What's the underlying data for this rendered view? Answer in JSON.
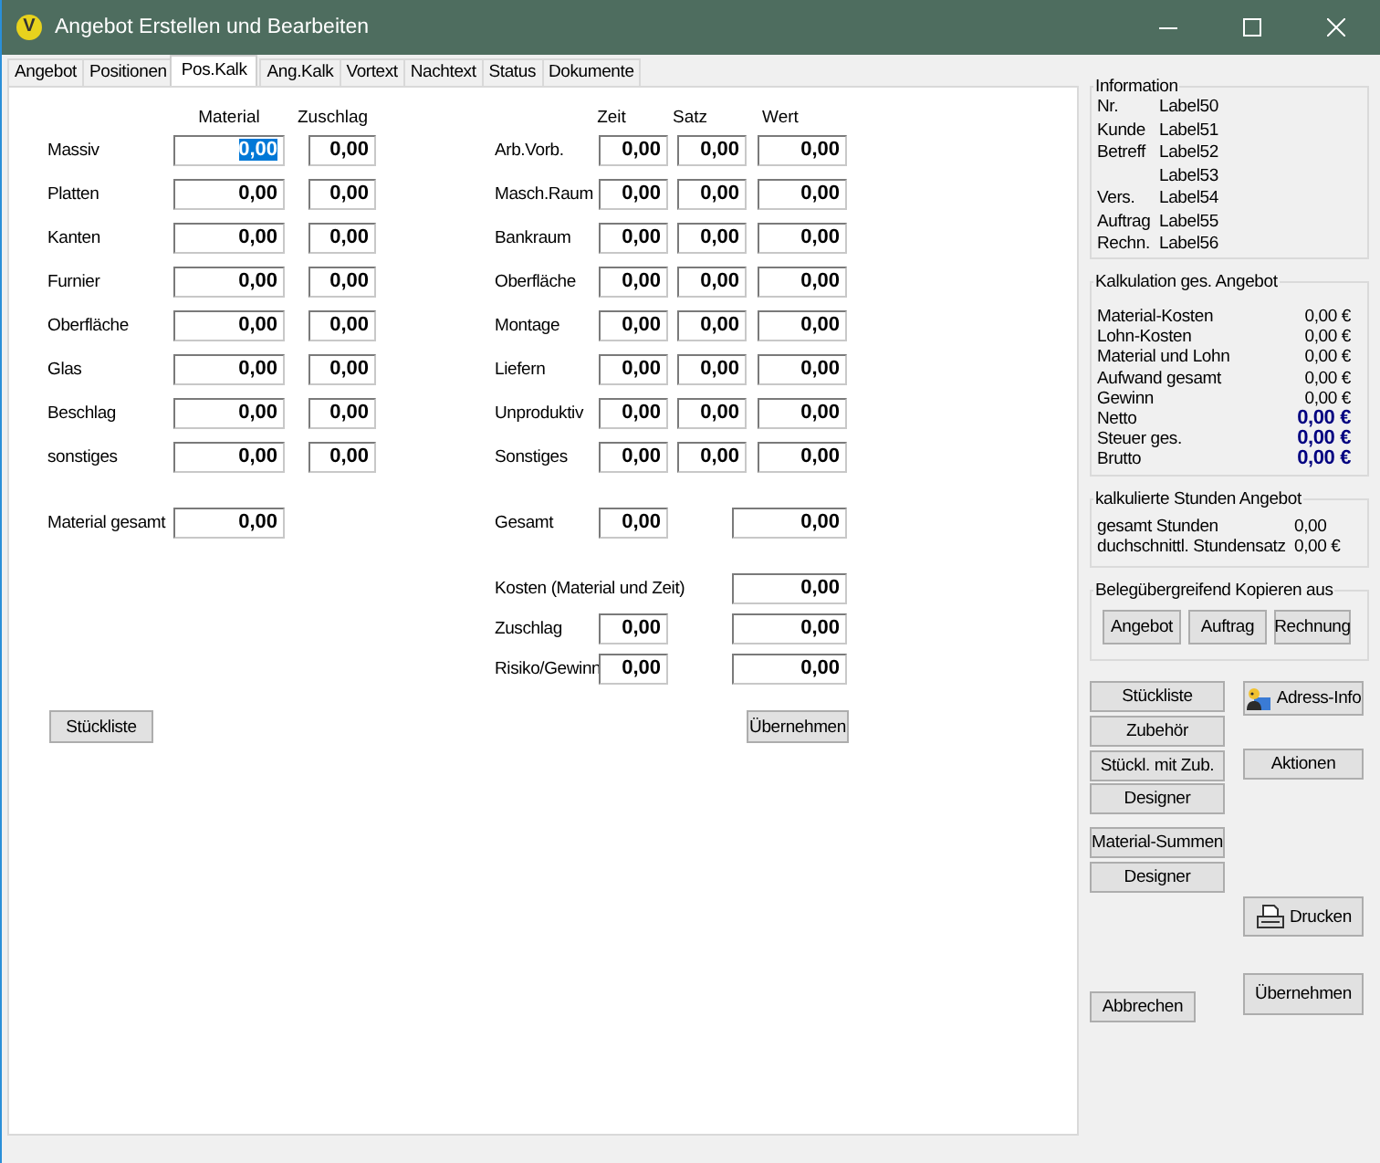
{
  "window": {
    "icon_letter": "V",
    "title": "Angebot Erstellen und Bearbeiten"
  },
  "tabs": [
    {
      "label": "Angebot",
      "selected": false
    },
    {
      "label": "Positionen",
      "selected": false
    },
    {
      "label": "Pos.Kalk",
      "selected": true
    },
    {
      "label": "Ang.Kalk",
      "selected": false
    },
    {
      "label": "Vortext",
      "selected": false
    },
    {
      "label": "Nachtext",
      "selected": false
    },
    {
      "label": "Status",
      "selected": false
    },
    {
      "label": "Dokumente",
      "selected": false
    }
  ],
  "material": {
    "headers": [
      "Material",
      "Zuschlag"
    ],
    "rows": [
      {
        "label": "Massiv",
        "material": "0,00",
        "zuschlag": "0,00",
        "selected": true
      },
      {
        "label": "Platten",
        "material": "0,00",
        "zuschlag": "0,00",
        "selected": false
      },
      {
        "label": "Kanten",
        "material": "0,00",
        "zuschlag": "0,00",
        "selected": false
      },
      {
        "label": "Furnier",
        "material": "0,00",
        "zuschlag": "0,00",
        "selected": false
      },
      {
        "label": "Oberfläche",
        "material": "0,00",
        "zuschlag": "0,00",
        "selected": false
      },
      {
        "label": "Glas",
        "material": "0,00",
        "zuschlag": "0,00",
        "selected": false
      },
      {
        "label": "Beschlag",
        "material": "0,00",
        "zuschlag": "0,00",
        "selected": false
      },
      {
        "label": "sonstiges",
        "material": "0,00",
        "zuschlag": "0,00",
        "selected": false
      }
    ],
    "total": {
      "label": "Material gesamt",
      "value": "0,00"
    }
  },
  "zeit": {
    "headers": [
      "Zeit",
      "Satz",
      "Wert"
    ],
    "rows": [
      {
        "label": "Arb.Vorb.",
        "zeit": "0,00",
        "satz": "0,00",
        "wert": "0,00"
      },
      {
        "label": "Masch.Raum",
        "zeit": "0,00",
        "satz": "0,00",
        "wert": "0,00"
      },
      {
        "label": "Bankraum",
        "zeit": "0,00",
        "satz": "0,00",
        "wert": "0,00"
      },
      {
        "label": "Oberfläche",
        "zeit": "0,00",
        "satz": "0,00",
        "wert": "0,00"
      },
      {
        "label": "Montage",
        "zeit": "0,00",
        "satz": "0,00",
        "wert": "0,00"
      },
      {
        "label": "Liefern",
        "zeit": "0,00",
        "satz": "0,00",
        "wert": "0,00"
      },
      {
        "label": "Unproduktiv",
        "zeit": "0,00",
        "satz": "0,00",
        "wert": "0,00"
      },
      {
        "label": "Sonstiges",
        "zeit": "0,00",
        "satz": "0,00",
        "wert": "0,00"
      }
    ],
    "total": {
      "label": "Gesamt",
      "zeit": "0,00",
      "wert": "0,00"
    },
    "kosten": [
      {
        "label": "Kosten (Material und Zeit)",
        "wert": "0,00"
      },
      {
        "label": "Zuschlag",
        "zeit": "0,00",
        "wert": "0,00"
      },
      {
        "label": "Risiko/Gewinn",
        "zeit": "0,00",
        "wert": "0,00"
      }
    ]
  },
  "panel_buttons": [
    "Stückliste",
    "Übernehmen"
  ],
  "information": {
    "title": "Information",
    "rows": [
      {
        "key": "Nr.",
        "value": "Label50"
      },
      {
        "key": "Kunde",
        "value": "Label51"
      },
      {
        "key": "Betreff",
        "value": "Label52"
      },
      {
        "value": "Label53"
      },
      {
        "key": "Vers.",
        "value": "Label54"
      },
      {
        "key": "Auftrag",
        "value": "Label55"
      },
      {
        "key": "Rechn.",
        "value": "Label56"
      }
    ]
  },
  "kalkulation": {
    "title": "Kalkulation ges. Angebot",
    "rows": [
      {
        "label": "Material-Kosten",
        "value": "0,00 €",
        "highlighted": false
      },
      {
        "label": "Lohn-Kosten",
        "value": "0,00 €",
        "highlighted": false
      },
      {
        "label": "Material und Lohn",
        "value": "0,00 €",
        "highlighted": false
      },
      {
        "label": "Aufwand gesamt",
        "value": "0,00 €",
        "highlighted": false
      },
      {
        "label": "Gewinn",
        "value": "0,00 €",
        "highlighted": false
      },
      {
        "label": "Netto",
        "value": "0,00 €",
        "highlighted": true
      },
      {
        "label": "Steuer ges.",
        "value": "0,00 €",
        "highlighted": true
      },
      {
        "label": "Brutto",
        "value": "0,00 €",
        "highlighted": true
      }
    ]
  },
  "stunden": {
    "title": "kalkulierte Stunden Angebot",
    "rows": [
      {
        "label": "gesamt Stunden",
        "value": "0,00"
      },
      {
        "label": "duchschnittl. Stundensatz",
        "value": "0,00 €"
      }
    ]
  },
  "kopieren": {
    "title": "Belegübergreifend Kopieren aus",
    "buttons": [
      "Angebot",
      "Auftrag",
      "Rechnung"
    ]
  },
  "left_buttons": [
    "Stückliste",
    "Zubehör",
    "Stückl. mit Zub.",
    "Designer",
    "Material-Summen",
    "Designer",
    "Abbrechen"
  ],
  "right_buttons": [
    {
      "label": "Adress-Info",
      "kind": "address"
    },
    {
      "label": "Aktionen",
      "kind": "plain"
    },
    {
      "label": "Drucken",
      "kind": "printer"
    },
    {
      "label": "Übernehmen",
      "kind": "plain"
    }
  ]
}
